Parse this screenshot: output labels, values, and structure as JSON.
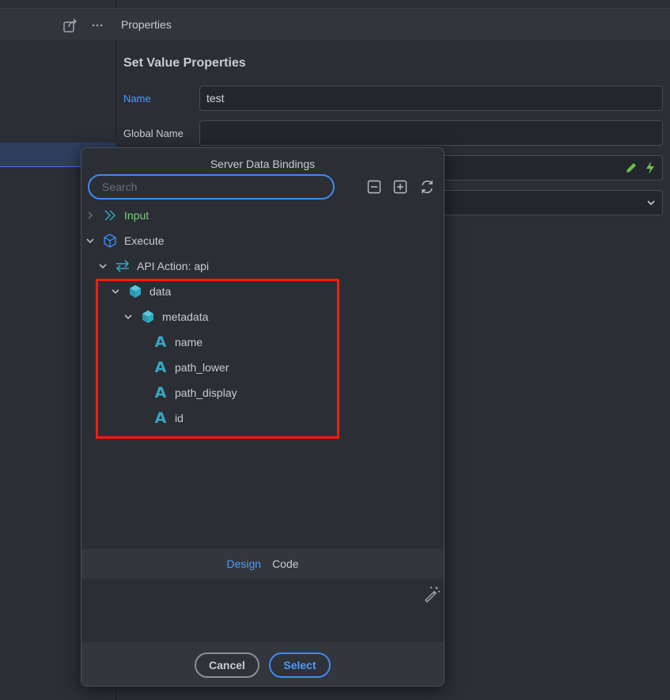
{
  "properties": {
    "header": "Properties",
    "title": "Set Value Properties",
    "fields": {
      "name_label": "Name",
      "name_value": "test",
      "global_name_label": "Global Name",
      "global_name_value": ""
    }
  },
  "modal": {
    "title": "Server Data Bindings",
    "search_placeholder": "Search",
    "tree": {
      "input": "Input",
      "execute": "Execute",
      "api_action": "API Action: api",
      "data": "data",
      "metadata": "metadata",
      "fields": [
        "name",
        "path_lower",
        "path_display",
        "id"
      ]
    },
    "tabs": {
      "design": "Design",
      "code": "Code"
    },
    "buttons": {
      "cancel": "Cancel",
      "select": "Select"
    }
  },
  "icons": {
    "share": "share-icon",
    "more": "more-icon",
    "collapse": "collapse-all-icon",
    "expand": "expand-all-icon",
    "refresh": "refresh-icon",
    "wand": "magic-wand-icon",
    "edit": "pencil-icon",
    "lightning": "lightning-icon"
  },
  "colors": {
    "accent": "#3d8bf2",
    "highlight": "#ff1a0a",
    "input_green": "#7fc97b",
    "data_icon": "#35a7c1"
  }
}
